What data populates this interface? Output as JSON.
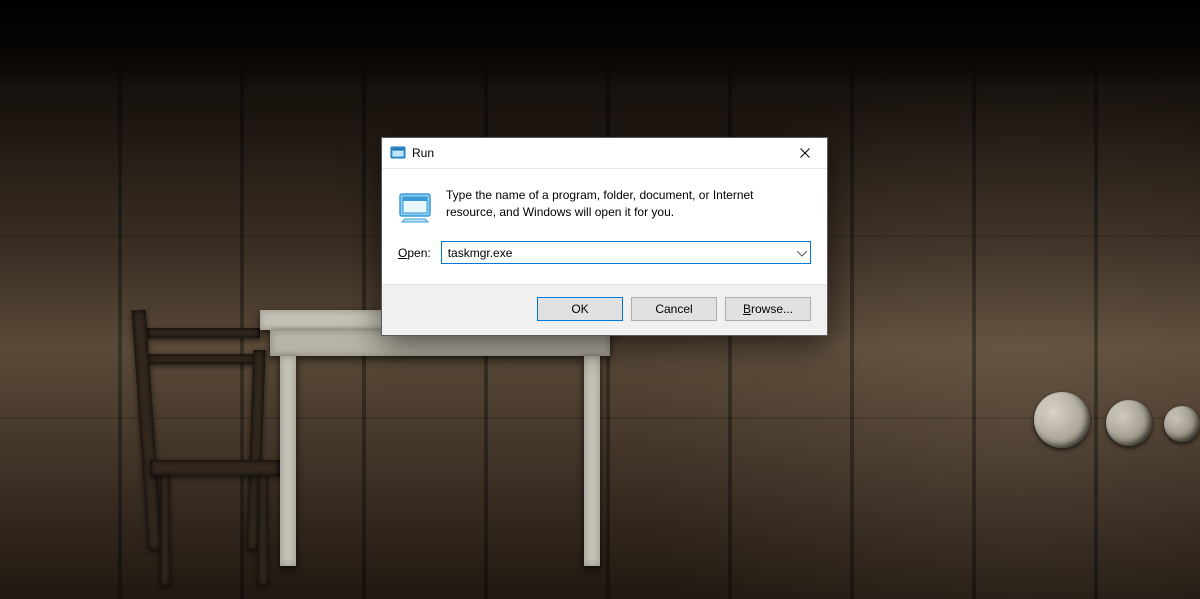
{
  "dialog": {
    "title": "Run",
    "description": "Type the name of a program, folder, document, or Internet resource, and Windows will open it for you.",
    "open_label_prefix": "O",
    "open_label_rest": "pen:",
    "input_value": "taskmgr.exe",
    "buttons": {
      "ok": "OK",
      "cancel": "Cancel",
      "browse_prefix": "B",
      "browse_rest": "rowse..."
    }
  }
}
